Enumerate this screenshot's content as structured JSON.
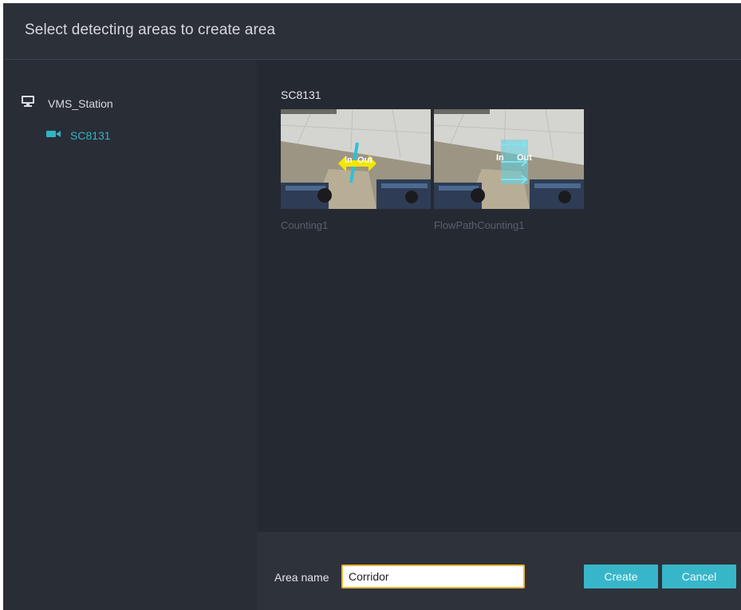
{
  "dialog": {
    "title": "Select detecting areas to create area"
  },
  "sidebar": {
    "station": {
      "label": "VMS_Station",
      "icon": "monitor-icon"
    },
    "camera": {
      "label": "SC8131",
      "icon": "video-camera-icon",
      "color": "#2fb4c8"
    }
  },
  "main": {
    "device_name": "SC8131",
    "rules": [
      {
        "name": "Counting1",
        "in_label": "In",
        "out_label": "Out",
        "marker_color": "#f3e600",
        "line_color": "#2fc1d8"
      },
      {
        "name": "FlowPathCounting1",
        "in_label": "In",
        "out_label": "Out",
        "marker_color": "#7fe3f0"
      }
    ]
  },
  "footer": {
    "area_name_label": "Area name",
    "area_name_value": "Corridor",
    "create_label": "Create",
    "cancel_label": "Cancel",
    "accent_color": "#38b6c9",
    "focus_color": "#e8b83a"
  }
}
